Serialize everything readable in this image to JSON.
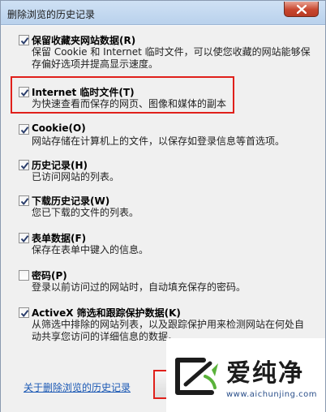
{
  "window": {
    "title": "删除浏览的历史记录"
  },
  "items": [
    {
      "title": "保留收藏夹网站数据(R)",
      "desc": "保留 Cookie 和 Internet 临时文件，可以使您收藏的网站能够保存偏好选项并提高显示速度。",
      "checked": true
    },
    {
      "title": "Internet 临时文件(T)",
      "desc": "为快速查看而保存的网页、图像和媒体的副本",
      "checked": true
    },
    {
      "title": "Cookie(O)",
      "desc": "网站存储在计算机上的文件，以保存如登录信息等首选项。",
      "checked": true
    },
    {
      "title": "历史记录(H)",
      "desc": "已访问网站的列表。",
      "checked": true
    },
    {
      "title": "下载历史记录(W)",
      "desc": "您已下载的文件的列表。",
      "checked": true
    },
    {
      "title": "表单数据(F)",
      "desc": "保存在表单中键入的信息。",
      "checked": true
    },
    {
      "title": "密码(P)",
      "desc": "登录以前访问过的网站时，自动填充保存的密码。",
      "checked": false
    },
    {
      "title": "ActiveX 筛选和跟踪保护数据(K)",
      "desc": "从筛选中排除的网站列表，以及跟踪保护用来检测网站在何处自动共享您访问的详细信息的数据。",
      "checked": true
    }
  ],
  "footer": {
    "link": "关于删除浏览的历史记录"
  },
  "watermark": {
    "brand": "爱纯净",
    "url": "www.aichunjing.com"
  }
}
